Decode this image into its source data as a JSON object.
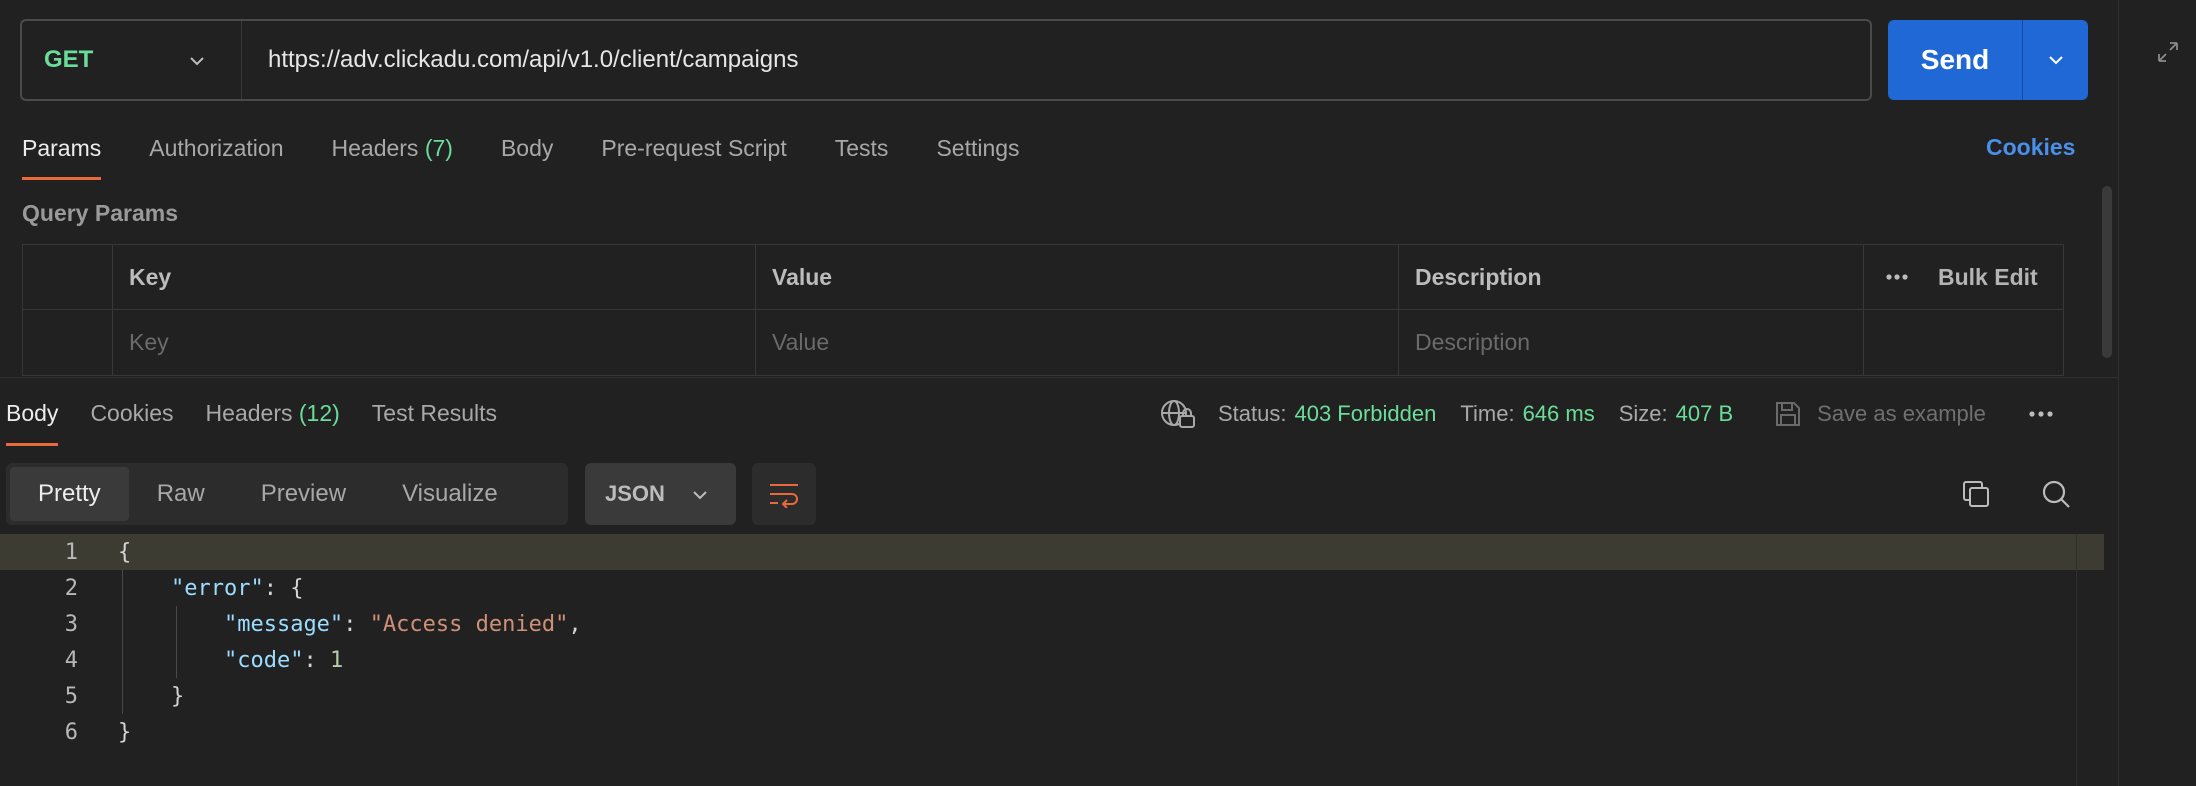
{
  "request": {
    "method": "GET",
    "url": "https://adv.clickadu.com/api/v1.0/client/campaigns",
    "send_label": "Send",
    "tabs": [
      {
        "label": "Params",
        "count": ""
      },
      {
        "label": "Authorization",
        "count": ""
      },
      {
        "label": "Headers",
        "count": "(7)"
      },
      {
        "label": "Body",
        "count": ""
      },
      {
        "label": "Pre-request Script",
        "count": ""
      },
      {
        "label": "Tests",
        "count": ""
      },
      {
        "label": "Settings",
        "count": ""
      }
    ],
    "active_tab": "Params",
    "cookies_label": "Cookies"
  },
  "query_params": {
    "title": "Query Params",
    "headers": {
      "key": "Key",
      "value": "Value",
      "description": "Description",
      "bulk_edit": "Bulk Edit"
    },
    "placeholders": {
      "key": "Key",
      "value": "Value",
      "description": "Description"
    }
  },
  "response": {
    "tabs": [
      {
        "label": "Body",
        "count": ""
      },
      {
        "label": "Cookies",
        "count": ""
      },
      {
        "label": "Headers",
        "count": "(12)"
      },
      {
        "label": "Test Results",
        "count": ""
      }
    ],
    "active_tab": "Body",
    "status_label": "Status:",
    "status_value": "403 Forbidden",
    "time_label": "Time:",
    "time_value": "646 ms",
    "size_label": "Size:",
    "size_value": "407 B",
    "save_example": "Save as example",
    "view_modes": [
      "Pretty",
      "Raw",
      "Preview",
      "Visualize"
    ],
    "active_view": "Pretty",
    "format": "JSON",
    "code_lines": [
      {
        "num": "1",
        "text": "{"
      },
      {
        "num": "2",
        "text": "    \"error\": {"
      },
      {
        "num": "3",
        "text": "        \"message\": \"Access denied\","
      },
      {
        "num": "4",
        "text": "        \"code\": 1"
      },
      {
        "num": "5",
        "text": "    }"
      },
      {
        "num": "6",
        "text": "}"
      }
    ]
  },
  "colors": {
    "accent_orange": "#e8693a",
    "status_green": "#6bdd9a",
    "send_blue": "#1f68d6",
    "cookies_blue": "#4a90ea"
  }
}
